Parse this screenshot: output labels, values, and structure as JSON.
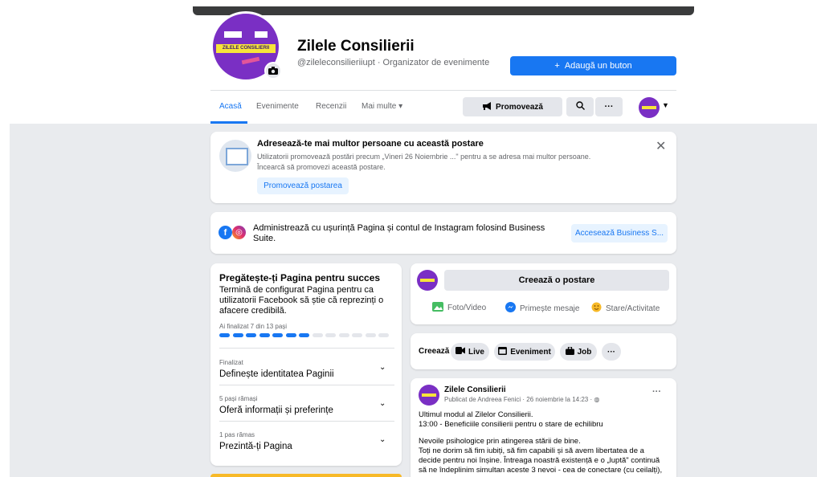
{
  "page": {
    "name": "Zilele Consilierii",
    "subtitle": "@zileleconsilieriiupt · Organizator de evenimente",
    "avatar_banner_text": "ZILELE CONSILIERII",
    "add_button": "Adaugă un buton",
    "add_button_icon": "plus-icon"
  },
  "tabs": [
    {
      "label": "Acasă",
      "active": true
    },
    {
      "label": "Evenimente"
    },
    {
      "label": "Recenzii"
    },
    {
      "label": "Mai multe ▾"
    }
  ],
  "toolbar": {
    "promote_label": "Promovează",
    "promote_icon": "megaphone-icon",
    "search_icon": "search-icon",
    "more_label": "···"
  },
  "promo_card": {
    "title": "Adresează-te mai multor persoane cu această postare",
    "body_line1": "Utilizatorii promovează postări precum „Vineri 26 Noiembrie ...\" pentru a se adresa mai multor persoane.",
    "body_line2": "Încearcă să promovezi această postare.",
    "button": "Promovează postarea",
    "close": "✕"
  },
  "business_card": {
    "text_line1": "Administrează cu ușurință Pagina și contul de Instagram folosind Business",
    "text_line2": "Suite.",
    "button": "Accesează Business S..."
  },
  "setup_card": {
    "title": "Pregătește-ți Pagina pentru succes",
    "desc_line1": "Termină de configurat Pagina pentru ca",
    "desc_line2": "utilizatorii Facebook să știe că reprezinți o",
    "desc_line3": "afacere credibilă.",
    "progress_label": "Ai finalizat 7 din 13 pași",
    "progress_done": 7,
    "progress_total": 13,
    "rows": [
      {
        "status": "Finalizat",
        "title": "Definește identitatea Paginii"
      },
      {
        "status": "5 pași rămași",
        "title": "Oferă informații și preferințe"
      },
      {
        "status": "1 pas rămas",
        "title": "Prezintă-ți Pagina"
      }
    ]
  },
  "composer": {
    "create_post": "Creează o postare",
    "actions": [
      {
        "label": "Foto/Video",
        "icon": "photo-icon",
        "color": "#45bd62"
      },
      {
        "label": "Primește mesaje",
        "icon": "messenger-icon",
        "color": "#1877f2"
      },
      {
        "label": "Stare/Activitate",
        "icon": "emoji-icon",
        "color": "#f7b928"
      }
    ]
  },
  "create_bar": {
    "label": "Creează",
    "pills": [
      {
        "label": "Live",
        "icon": "video-icon"
      },
      {
        "label": "Eveniment",
        "icon": "calendar-icon"
      },
      {
        "label": "Job",
        "icon": "briefcase-icon"
      }
    ],
    "more": "···"
  },
  "post": {
    "author": "Zilele Consilierii",
    "meta": "Publicat de Andreea Fenici · 26 noiembrie la 14:23 · ",
    "lines": [
      "Ultimul modul al Zilelor Consilierii.",
      "13:00 - Beneficiile consilierii pentru o stare de echilibru",
      "",
      "  Nevoile psihologice prin atingerea stării de bine.",
      "Toți ne dorim să fim iubiți, să fim capabili și să avem libertatea de a",
      "decide pentru noi înșine. Întreaga noastră existență e o „luptă\" continuă",
      "să ne îndeplinim simultan aceste 3 nevoi - cea de conectare (cu ceilalți),"
    ],
    "more": "···"
  },
  "colors": {
    "accent": "#1877f2",
    "brand_purple": "#7a2fc4",
    "brand_yellow": "#f7e43a",
    "progress_empty": "#e4e6eb"
  }
}
